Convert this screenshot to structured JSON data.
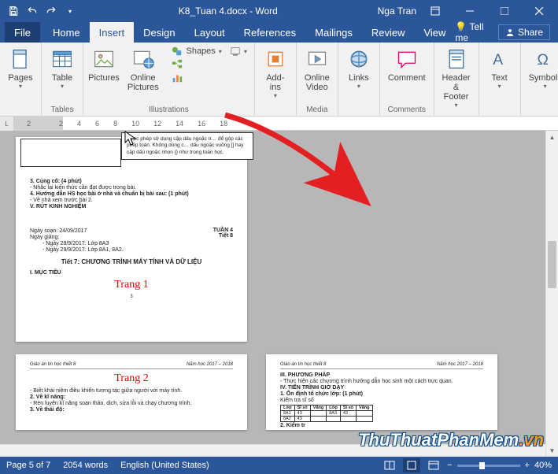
{
  "title": "K8_Tuan 4.docx - Word",
  "user": "Nga Tran",
  "tabs": {
    "file": "File",
    "home": "Home",
    "insert": "Insert",
    "design": "Design",
    "layout": "Layout",
    "references": "References",
    "mailings": "Mailings",
    "review": "Review",
    "view": "View",
    "tellme": "Tell me",
    "share": "Share"
  },
  "ribbon": {
    "pages": {
      "label": "Pages",
      "btn": "Pages"
    },
    "tables": {
      "label": "Tables",
      "btn": "Table"
    },
    "illustrations": {
      "label": "Illustrations",
      "pictures": "Pictures",
      "online_pictures": "Online Pictures",
      "shapes": "Shapes",
      "smartart": "",
      "chart": "",
      "screenshot": ""
    },
    "addins": {
      "label": "",
      "btn": "Add-ins"
    },
    "media": {
      "label": "Media",
      "btn": "Online Video"
    },
    "links": {
      "label": "",
      "btn": "Links"
    },
    "comments": {
      "label": "Comments",
      "btn": "Comment"
    },
    "headerfooter": {
      "label": "",
      "btn": "Header & Footer"
    },
    "text": {
      "label": "",
      "btn": "Text"
    },
    "symbols": {
      "label": "",
      "btn": "Symbols"
    }
  },
  "ruler": {
    "marks": [
      "2",
      "",
      "2",
      "4",
      "6",
      "8",
      "10",
      "12",
      "14",
      "16",
      "18"
    ]
  },
  "doc": {
    "callout": "được phép sử dụng cặp dấu ngoặc tr… để gộp các phép toán. Không dùng c… dấu ngoặc vuông [] hay cặp dấu ngoặc nhọn {} như trong toán học.",
    "p1": {
      "l1": "3. Củng cố: (4 phút)",
      "l2": "- Nhắc lại kiến thức cần đạt được trong bài.",
      "l3": "4. Hướng dẫn HS học bài ở nhà và chuẩn bị bài sau: (1 phút)",
      "l4": "- Về nhà xem trước bài 2.",
      "l5": "V. RÚT KINH NGHIỆM",
      "date1": "Ngày soạn: 24/09/2017",
      "date2": "Ngày giảng:",
      "date3": "- Ngày 28/9/2017: Lớp 8A3",
      "date4": "- Ngày 29/9/2017: Lớp 8A1, 8A2.",
      "tuan": "TUẦN 4",
      "tiet": "Tiết 8",
      "title": "Tiết 7: CHƯƠNG TRÌNH MÁY TÍNH VÀ DỮ LIỆU",
      "muc": "I. MỤC TIÊU",
      "trang": "Trang 1",
      "pagenum": "3"
    },
    "hdr": {
      "left": "Giáo án tin học thiết 8",
      "right": "Năm học 2017 – 2018"
    },
    "p2": {
      "trang": "Trang 2",
      "l1": "- Biết khái niệm điều khiển tương tác giữa người với máy tính.",
      "l2": "2. Về kĩ năng:",
      "l3": "- Rèn luyện kĩ năng soạn thảo, dịch, sửa lỗi và chạy chương trình.",
      "l4": "3. Về thái độ:"
    },
    "p3": {
      "l1": "III. PHƯƠNG PHÁP",
      "l2": "- Thực hiện các chương trình hướng dẫn học sinh một cách trực quan.",
      "l3": "IV. TIẾN TRÌNH GIỜ DẠY",
      "l4": "1. Ổn định tổ chức lớp: (1 phút)",
      "l5": "Kiểm tra sĩ số",
      "table": {
        "h": [
          "Lớp",
          "Sĩ số",
          "Vắng",
          "Lớp",
          "Sĩ số",
          "Vắng"
        ],
        "r1": [
          "8A1",
          "43",
          "",
          "8A3",
          "43",
          ""
        ],
        "r2": [
          "8A2",
          "43",
          "",
          "",
          "",
          ""
        ]
      },
      "l6": "2. Kiểm tr"
    }
  },
  "status": {
    "page": "Page 5 of 7",
    "words": "2054 words",
    "lang": "English (United States)",
    "zoom": "40%"
  },
  "watermark": {
    "a": "ThuThuatPhanMem",
    "b": ".vn"
  }
}
